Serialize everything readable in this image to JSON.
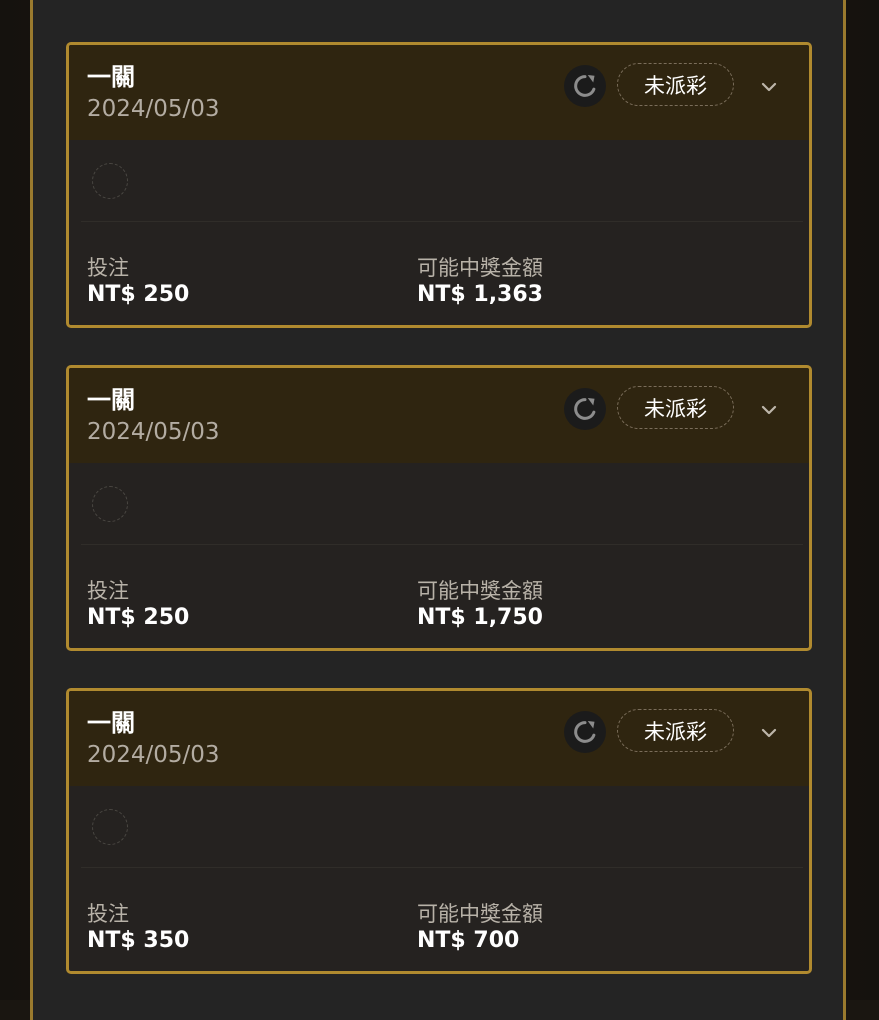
{
  "bets": [
    {
      "type": "一關",
      "date": "2024/05/03",
      "status": "未派彩",
      "stake_label": "投注",
      "stake": "NT$ 250",
      "payout_label": "可能中獎金額",
      "payout": "NT$ 1,363"
    },
    {
      "type": "一關",
      "date": "2024/05/03",
      "status": "未派彩",
      "stake_label": "投注",
      "stake": "NT$ 250",
      "payout_label": "可能中獎金額",
      "payout": "NT$ 1,750"
    },
    {
      "type": "一關",
      "date": "2024/05/03",
      "status": "未派彩",
      "stake_label": "投注",
      "stake": "NT$ 350",
      "payout_label": "可能中獎金額",
      "payout": "NT$ 700"
    }
  ],
  "icons": {
    "refresh": "refresh-icon",
    "expand": "chevron-down-icon"
  },
  "colors": {
    "card_border": "#b08a2f",
    "card_header_bg": "#2f2510",
    "panel_bg": "#242424",
    "frame_border": "#9a7a2e"
  }
}
